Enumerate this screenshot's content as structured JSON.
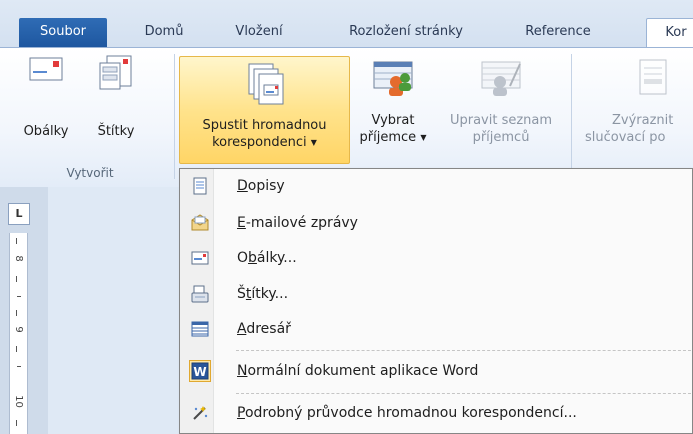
{
  "tabs": [
    {
      "label": "Soubor",
      "active": false,
      "file": true
    },
    {
      "label": "Domů"
    },
    {
      "label": "Vložení"
    },
    {
      "label": "Rozložení stránky"
    },
    {
      "label": "Reference"
    },
    {
      "label": "Kor",
      "active": true
    }
  ],
  "ribbon": {
    "create_group": {
      "label": "Vytvořit",
      "envelopes": "Obálky",
      "labels": "Štítky"
    },
    "start_merge": {
      "line1": "Spustit hromadnou",
      "line2": "korespondenci"
    },
    "select_recipients": {
      "line1": "Vybrat",
      "line2": "příjemce"
    },
    "edit_list": {
      "line1": "Upravit seznam",
      "line2": "příjemců"
    },
    "highlight_fields": {
      "line1": "Zvýraznit",
      "line2": "slučovací po"
    }
  },
  "ruler": {
    "corner": "L",
    "numbers": [
      "8",
      "9",
      "10"
    ]
  },
  "menu": {
    "items": [
      {
        "pre": "",
        "u": "D",
        "post": "opisy",
        "icon": "letter-icon"
      },
      {
        "pre": "",
        "u": "E",
        "post": "-mailové zprávy",
        "icon": "email-envelope-icon"
      },
      {
        "pre": "O",
        "u": "b",
        "post": "álky...",
        "icon": "envelope-icon"
      },
      {
        "pre": "Š",
        "u": "t",
        "post": "ítky...",
        "icon": "labels-icon"
      },
      {
        "pre": "",
        "u": "A",
        "post": "dresář",
        "icon": "directory-icon"
      },
      {
        "pre": "",
        "u": "N",
        "post": "ormální dokument aplikace Word",
        "icon": "word-icon"
      },
      {
        "pre": "",
        "u": "P",
        "post": "odrobný průvodce hromadnou korespondencí...",
        "icon": "wizard-icon"
      }
    ]
  },
  "colors": {
    "file_tab": "#2f6cb5",
    "highlight": "#ffe38c",
    "ribbon_bg": "#f2f6fc",
    "word_blue": "#2a5699"
  }
}
